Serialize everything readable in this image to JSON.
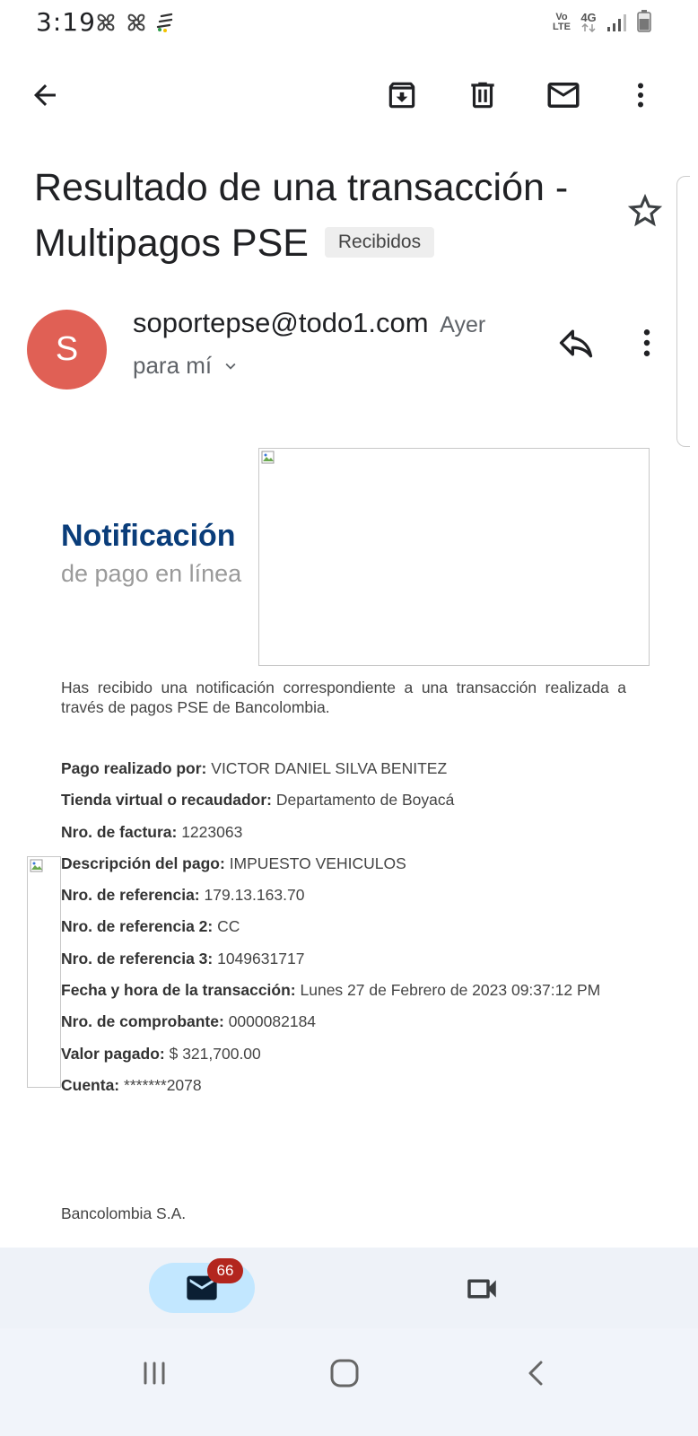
{
  "status_bar": {
    "time": "3:19",
    "volte_top": "Vo",
    "volte_bottom": "LTE",
    "network": "4G"
  },
  "toolbar": {
    "back": "arrow-back-icon",
    "archive": "archive-icon",
    "delete": "trash-icon",
    "mark_unread": "mail-icon",
    "more": "more-vert-icon"
  },
  "email": {
    "subject": "Resultado de una transacción - Multipagos PSE",
    "label": "Recibidos",
    "sender_initial": "S",
    "sender": "soportepse@todo1.com",
    "when": "Ayer",
    "recipient": "para mí"
  },
  "body": {
    "title": "Notificación",
    "subtitle": "de pago en línea",
    "intro": "Has recibido una notificación correspondiente a una transacción realizada a través de pagos PSE de Bancolombia.",
    "details": [
      {
        "label": "Pago realizado por:",
        "value": "VICTOR DANIEL SILVA BENITEZ"
      },
      {
        "label": "Tienda virtual o recaudador:",
        "value": "Departamento de Boyacá"
      },
      {
        "label": "Nro. de factura:",
        "value": "1223063"
      },
      {
        "label": "Descripción del pago:",
        "value": "IMPUESTO VEHICULOS"
      },
      {
        "label": "Nro. de referencia:",
        "value": "179.13.163.70"
      },
      {
        "label": "Nro. de referencia 2:",
        "value": "CC"
      },
      {
        "label": "Nro. de referencia 3:",
        "value": "1049631717"
      },
      {
        "label": "Fecha y hora de la transacción:",
        "value": "Lunes 27 de Febrero de 2023 09:37:12 PM"
      },
      {
        "label": "Nro. de comprobante:",
        "value": "0000082184"
      },
      {
        "label": "Valor pagado:",
        "value": "$ 321,700.00"
      },
      {
        "label": "Cuenta:",
        "value": "*******2078"
      }
    ],
    "company": "Bancolombia S.A."
  },
  "bottom_nav": {
    "mail_badge": "66"
  },
  "colors": {
    "avatar": "#e06055",
    "title_blue": "#0a3d7a",
    "badge": "#b3261e",
    "mail_pill": "#c2e7ff"
  }
}
